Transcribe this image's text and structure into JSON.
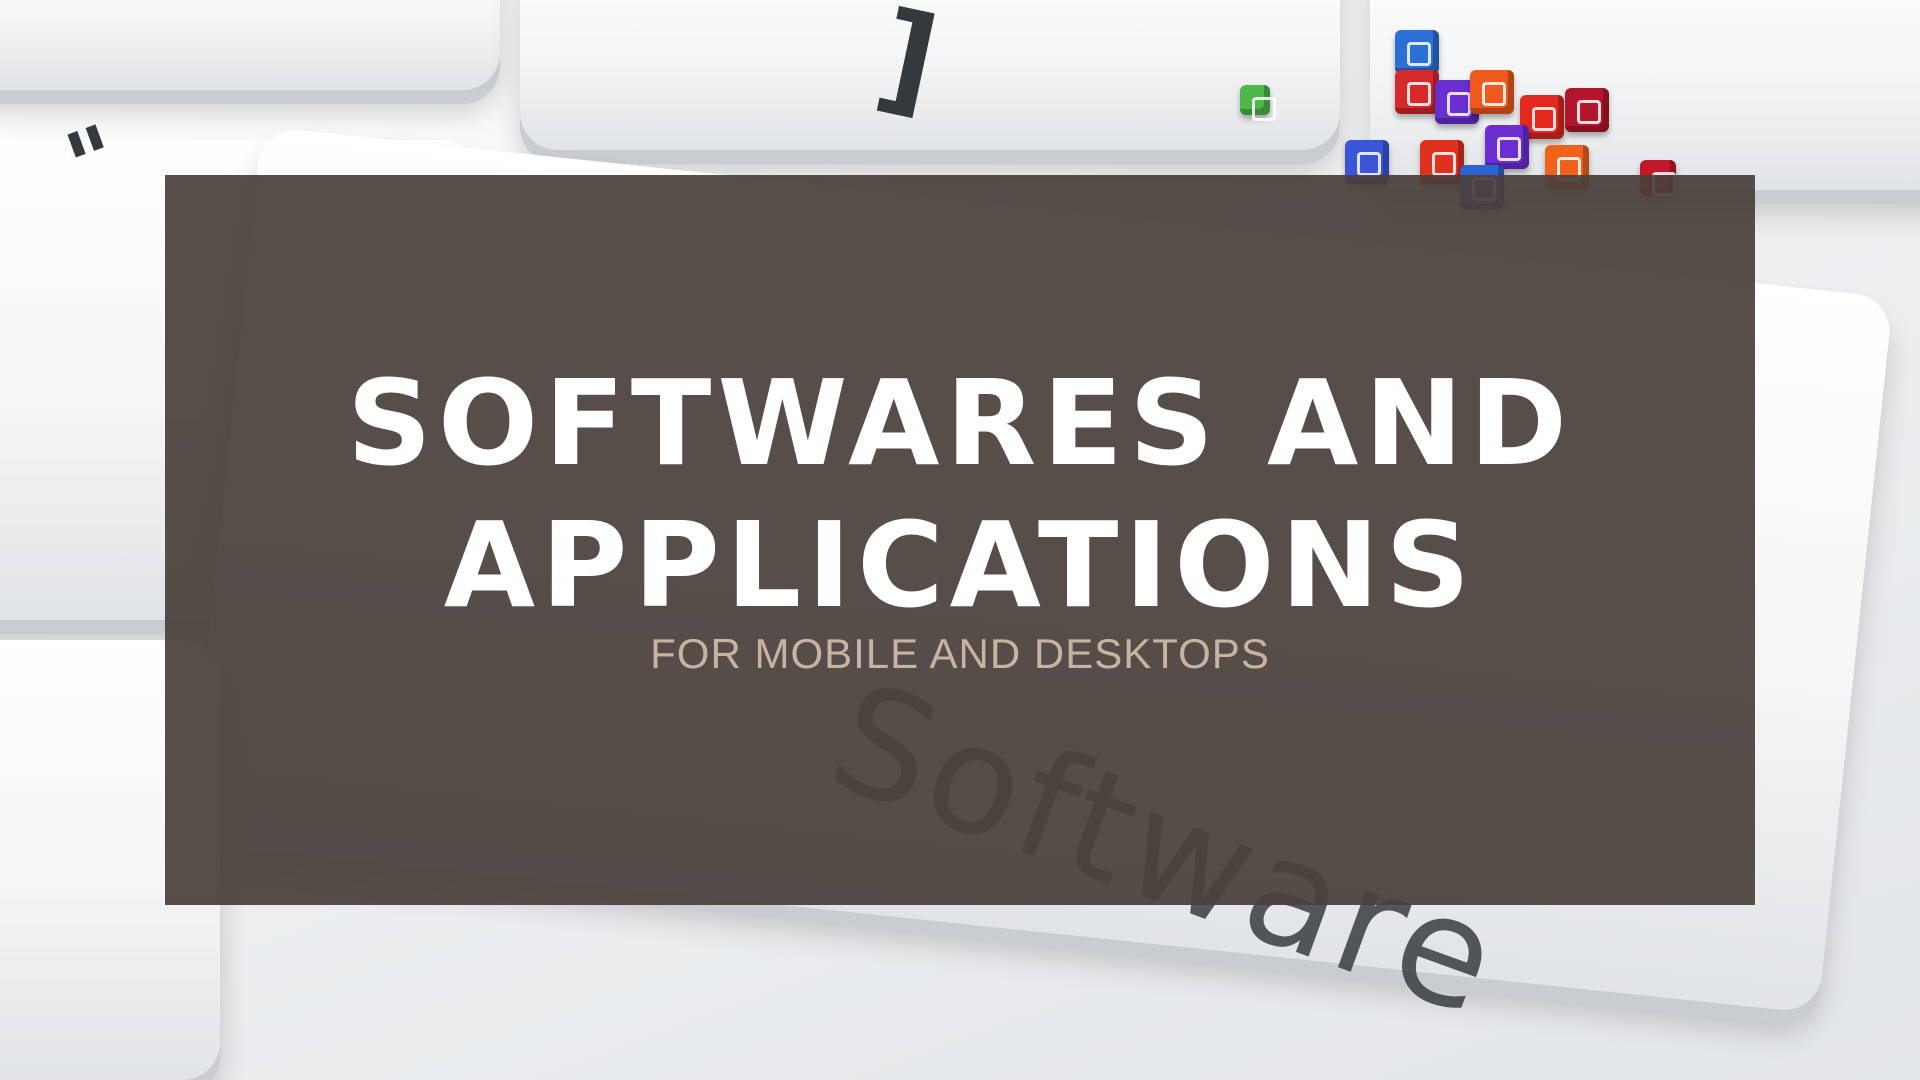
{
  "banner": {
    "title_line1": "SOFTWARES AND",
    "title_line2": "APPLICATIONS",
    "subtitle": "FOR MOBILE AND DESKTOPS"
  },
  "background": {
    "key_word": "Software",
    "colors": {
      "overlay": "#4a3f3b",
      "title": "#ffffff",
      "subtitle": "#c5b4a2"
    }
  }
}
